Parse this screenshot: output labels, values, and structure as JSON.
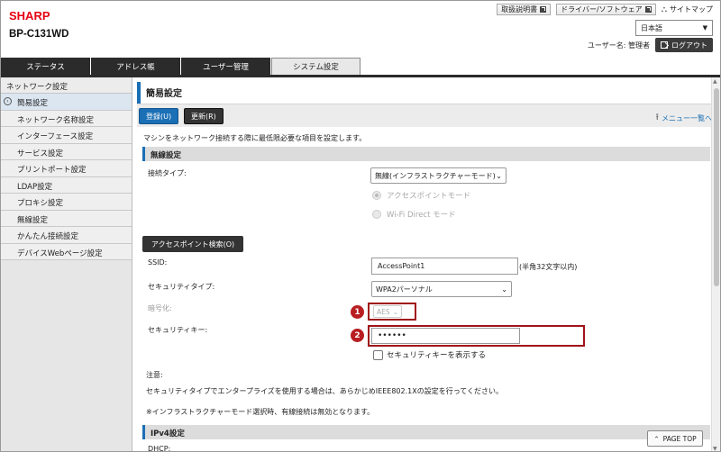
{
  "header": {
    "logo": "SHARP",
    "model": "BP-C131WD",
    "links": [
      "取扱説明書",
      "ドライバー/ソフトウェア"
    ],
    "sitemap": "サイトマップ",
    "language": "日本語",
    "username": "ユーザー名: 管理者",
    "logout": "ログアウト"
  },
  "tabs": [
    "ステータス",
    "アドレス帳",
    "ユーザー管理",
    "システム設定"
  ],
  "sidebar": {
    "header": "ネットワーク設定",
    "items": [
      "簡易設定",
      "ネットワーク名称設定",
      "インターフェース設定",
      "サービス設定",
      "プリントポート設定",
      "LDAP設定",
      "プロキシ設定",
      "無線設定",
      "かんたん接続設定",
      "デバイスWebページ設定"
    ]
  },
  "main": {
    "title": "簡易設定",
    "register": "登録(U)",
    "refresh": "更新(R)",
    "menu_list": "メニュー一覧へ",
    "description": "マシンをネットワーク接続する際に最低限必要な項目を設定します。",
    "wireless": {
      "section": "無線設定",
      "connection_type_label": "接続タイプ:",
      "connection_type_value": "無線(インフラストラクチャーモード)",
      "radio_ap": "アクセスポイントモード",
      "radio_wifidirect": "Wi-Fi Direct モード",
      "scan_button": "アクセスポイント検索(O)",
      "ssid_label": "SSID:",
      "ssid_value": "AccessPoint1",
      "ssid_hint": "(半角32文字以内)",
      "security_type_label": "セキュリティタイプ:",
      "security_type_value": "WPA2パーソナル",
      "encryption_label": "暗号化:",
      "encryption_value": "AES",
      "security_key_label": "セキュリティキー:",
      "security_key_value": "••••••",
      "show_key": "セキュリティキーを表示する",
      "note_title": "注意:",
      "note_body": "セキュリティタイプでエンタープライズを使用する場合は、あらかじめIEEE802.1Xの設定を行ってください。",
      "note_infra": "※インフラストラクチャーモード選択時、有線接続は無効となります。"
    },
    "ipv4": {
      "section": "IPv4設定",
      "dhcp_label": "DHCP:"
    },
    "callouts": [
      "1",
      "2"
    ],
    "page_top": "PAGE TOP"
  },
  "colors": {
    "brand": "#e60012",
    "accent": "#1a6fb5",
    "callout": "#b81e22"
  }
}
